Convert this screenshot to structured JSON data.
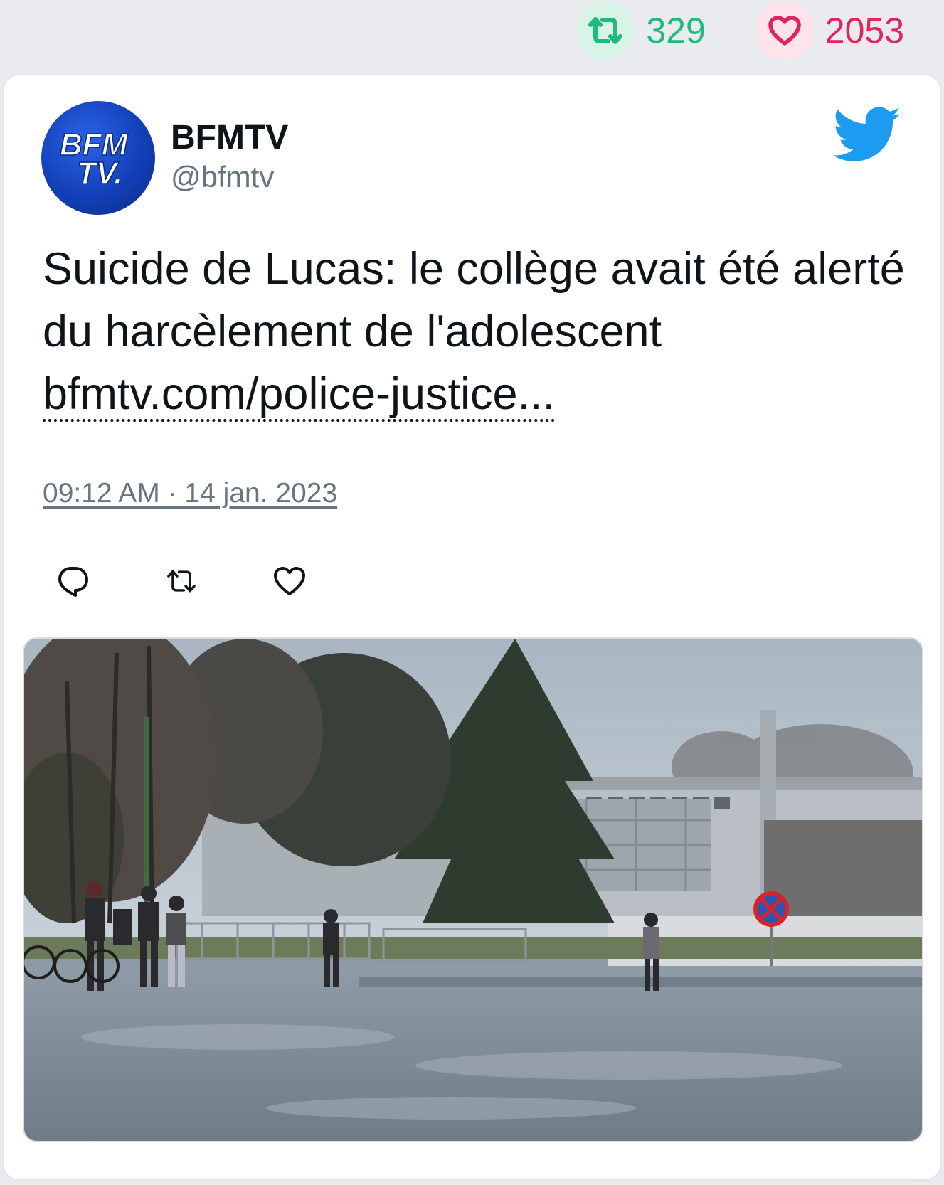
{
  "stats": {
    "retweets": "329",
    "likes": "2053"
  },
  "author": {
    "name": "BFMTV",
    "handle": "@bfmtv",
    "avatar_text_line1": "BFM",
    "avatar_text_line2": "TV."
  },
  "tweet": {
    "text": "Suicide de Lucas: le collège avait été alerté du harcèlement de l'adolescent",
    "link": "bfmtv.com/police-justice...",
    "timestamp": "09:12 AM · 14 jan. 2023"
  },
  "icons": {
    "retweet_stat": "retweet-icon",
    "like_stat": "heart-icon",
    "platform": "twitter-bird-icon",
    "reply_action": "reply-icon",
    "retweet_action": "retweet-icon",
    "like_action": "heart-icon"
  },
  "colors": {
    "retweet": "#1fba7c",
    "like": "#e0245e",
    "twitter_blue": "#1d9bf0",
    "muted_text": "#66757f",
    "avatar_blue": "#1340b8"
  },
  "media": {
    "alt": "Photo of a school building with trees, students standing by a wet parking lot"
  }
}
